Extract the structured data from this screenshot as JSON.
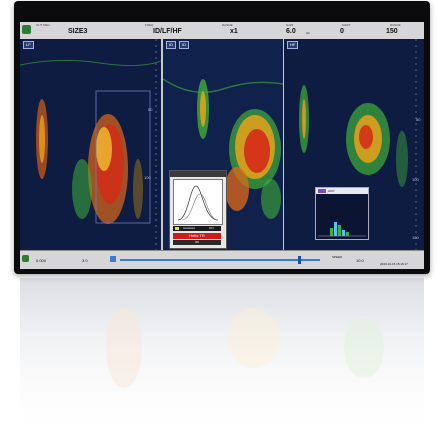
{
  "top_bar": {
    "icon": "green-square-icon",
    "cells": [
      {
        "label": "OUT MEU",
        "value": "SIZE3"
      },
      {
        "label": "FREQ",
        "value": "ID/LF/HF"
      },
      {
        "label": "RANGE",
        "value": "x1"
      },
      {
        "label": "GAIN",
        "value": "6.0",
        "unit": "HF"
      },
      {
        "label": "SHIFT",
        "value": "0"
      },
      {
        "label": "RANGE",
        "value": "150"
      }
    ]
  },
  "panes": [
    {
      "tag": "LF",
      "tag2": ""
    },
    {
      "tag": "ID",
      "tag2": "ID"
    },
    {
      "tag": "HF",
      "tag2": ""
    }
  ],
  "depth_labels": [
    "50",
    "100",
    "150"
  ],
  "popup": {
    "legend_label": "Assistant",
    "legend_value": "ON",
    "red_label": "Hello TR",
    "ok_label": "OK"
  },
  "popup2": {
    "title": "HIST"
  },
  "bottom_bar": {
    "left_value": "0.000",
    "speed_label": "3.0",
    "mid_label": "SPEED",
    "mid_value": "10.0",
    "datetime": "2020-10-15 15:16:17"
  },
  "colors": {
    "background": "#0e1c42",
    "bar": "#d6d6d8",
    "echo_strong": "#d42a18",
    "echo_mid": "#e8a21a",
    "echo_weak": "#3fae3a"
  }
}
